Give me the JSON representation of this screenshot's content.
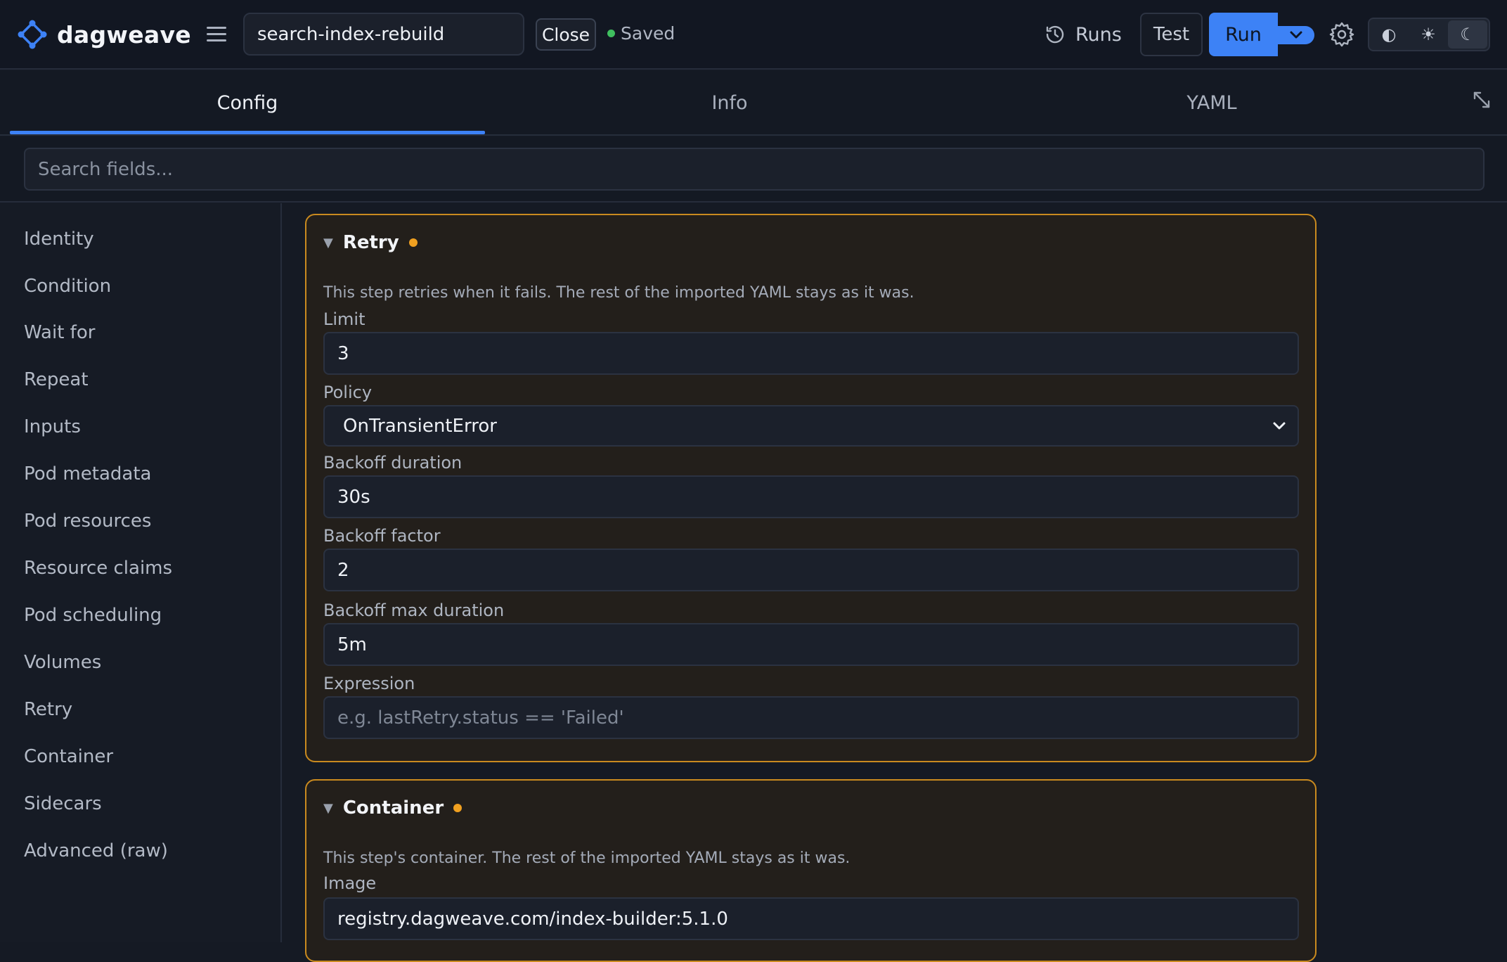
{
  "app": {
    "name": "dagweave"
  },
  "header": {
    "workflow_name": "search-index-rebuild",
    "close_label": "Close",
    "saved_label": "Saved",
    "runs_label": "Runs",
    "test_label": "Test",
    "run_label": "Run",
    "theme_options": [
      "◐",
      "☀",
      "☾"
    ]
  },
  "tabs": [
    {
      "label": "Config"
    },
    {
      "label": "Info"
    },
    {
      "label": "YAML"
    }
  ],
  "search": {
    "placeholder": "Search fields..."
  },
  "sidebar": {
    "items": [
      {
        "label": "Identity"
      },
      {
        "label": "Condition"
      },
      {
        "label": "Wait for"
      },
      {
        "label": "Repeat"
      },
      {
        "label": "Inputs"
      },
      {
        "label": "Pod metadata"
      },
      {
        "label": "Pod resources"
      },
      {
        "label": "Resource claims"
      },
      {
        "label": "Pod scheduling"
      },
      {
        "label": "Volumes"
      },
      {
        "label": "Retry"
      },
      {
        "label": "Container"
      },
      {
        "label": "Sidecars"
      },
      {
        "label": "Advanced (raw)"
      }
    ]
  },
  "retry": {
    "title": "Retry",
    "description": "This step retries when it fails. The rest of the imported YAML stays as it was.",
    "limit_label": "Limit",
    "limit_value": "3",
    "policy_label": "Policy",
    "policy_value": "OnTransientError",
    "backoff_duration_label": "Backoff duration",
    "backoff_duration_value": "30s",
    "backoff_factor_label": "Backoff factor",
    "backoff_factor_value": "2",
    "backoff_max_label": "Backoff max duration",
    "backoff_max_value": "5m",
    "expression_label": "Expression",
    "expression_placeholder": "e.g. lastRetry.status == 'Failed'"
  },
  "container": {
    "title": "Container",
    "description": "This step's container. The rest of the imported YAML stays as it was.",
    "image_label": "Image",
    "image_value": "registry.dagweave.com/index-builder:5.1.0"
  },
  "colors": {
    "accent": "#3d82f6",
    "modified": "#f0a020",
    "card_border": "#c98a1f",
    "saved": "#3fbf5f"
  }
}
